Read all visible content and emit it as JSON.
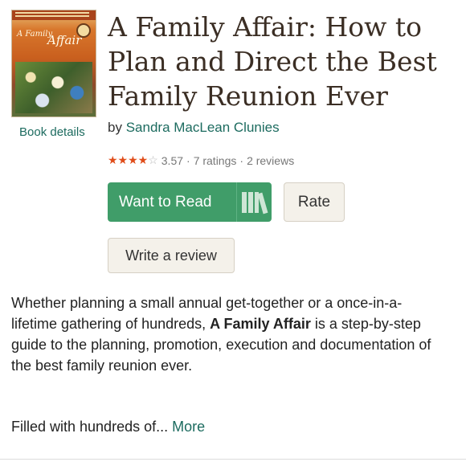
{
  "book": {
    "cover_title_a": "A Family",
    "cover_title_b": "Affair",
    "title": "A Family Affair: How to Plan and Direct the Best Family Reunion Ever",
    "details_link": "Book details",
    "by_label": "by",
    "author": "Sandra MacLean Clunies"
  },
  "rating": {
    "stars_filled": "★★★★",
    "stars_empty": "☆",
    "average": "3.57",
    "sep1": "·",
    "ratings_text": "7 ratings",
    "sep2": "·",
    "reviews_text": "2 reviews",
    "value": 3.57,
    "max": 5
  },
  "actions": {
    "want_to_read": "Want to Read",
    "rate": "Rate",
    "write_review": "Write a review",
    "shelf_icon": "bookshelf-icon"
  },
  "description": {
    "part1": "Whether planning a small annual get-together or a once-in-a-lifetime gathering of hundreds, ",
    "bold": "A Family Affair",
    "part2": " is a step-by-step guide to the planning, promotion, execution and documentation of the best family reunion ever.",
    "teaser": "Filled with hundreds of...",
    "more": "More"
  },
  "colors": {
    "accent_green": "#409d69",
    "link_teal": "#1c6b5f",
    "star_orange": "#e04d1a"
  }
}
